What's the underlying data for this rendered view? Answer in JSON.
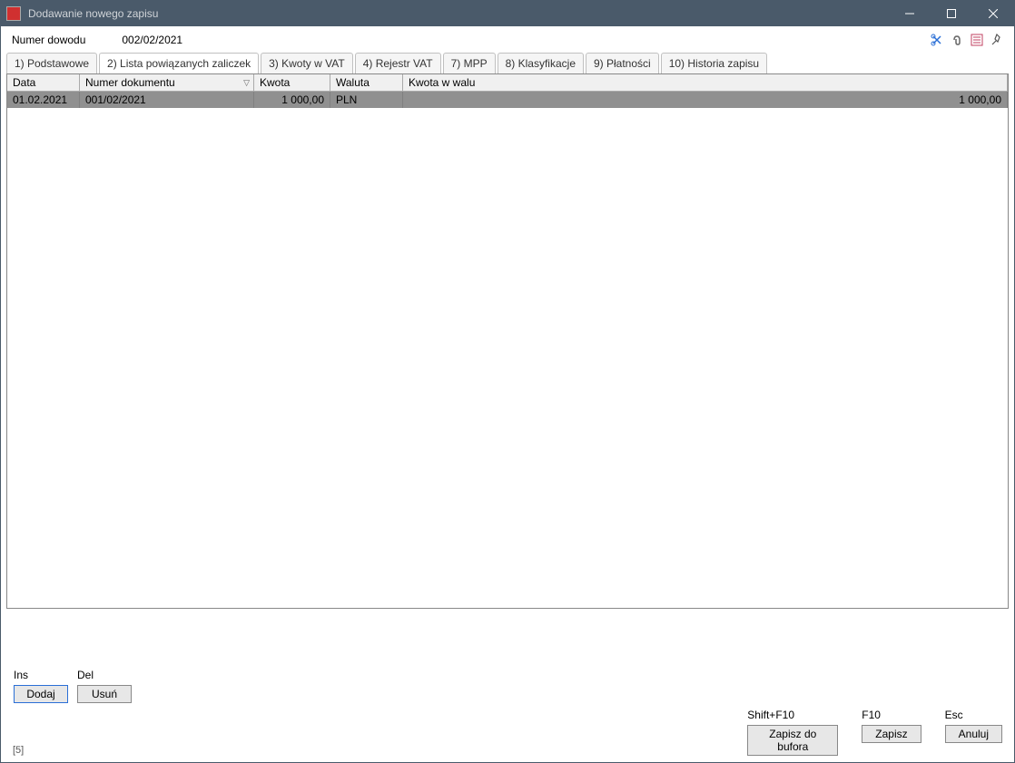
{
  "window": {
    "title": "Dodawanie nowego zapisu"
  },
  "header": {
    "label": "Numer dowodu",
    "value": "002/02/2021"
  },
  "tabs": [
    {
      "label": "1) Podstawowe"
    },
    {
      "label": "2) Lista powiązanych zaliczek"
    },
    {
      "label": "3) Kwoty w VAT"
    },
    {
      "label": "4) Rejestr VAT"
    },
    {
      "label": "7) MPP"
    },
    {
      "label": "8) Klasyfikacje"
    },
    {
      "label": "9) Płatności"
    },
    {
      "label": "10) Historia zapisu"
    }
  ],
  "active_tab": 1,
  "columns": {
    "c0": "Data",
    "c1": "Numer dokumentu",
    "c2": "Kwota",
    "c3": "Waluta",
    "c4": "Kwota w walu"
  },
  "rows": [
    {
      "data": "01.02.2021",
      "numer": "001/02/2021",
      "kwota": "1 000,00",
      "waluta": "PLN",
      "kwotaw": "1 000,00"
    }
  ],
  "actions": {
    "ins_label": "Ins",
    "del_label": "Del",
    "add": "Dodaj",
    "delete": "Usuń"
  },
  "footer": {
    "note": "[5]",
    "shift_f10": "Shift+F10",
    "f10": "F10",
    "esc": "Esc",
    "save_buffer": "Zapisz do bufora",
    "save": "Zapisz",
    "cancel": "Anuluj"
  }
}
